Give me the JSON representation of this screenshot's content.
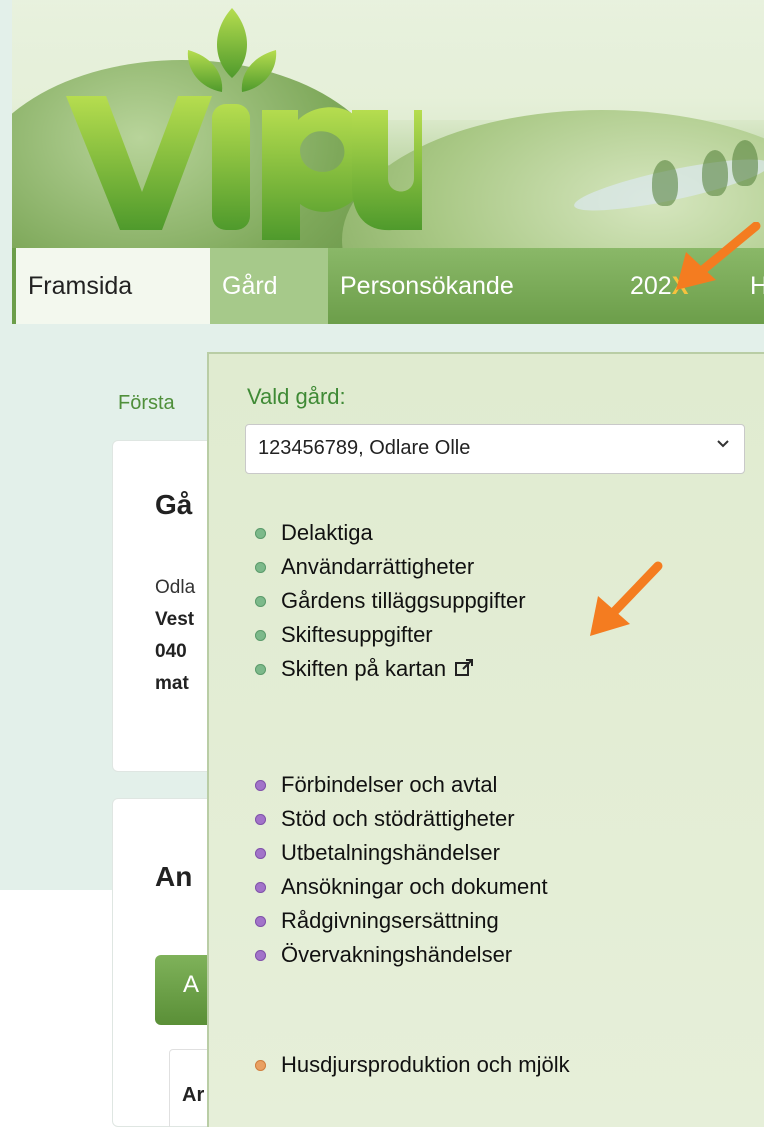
{
  "logo": {
    "text": "vipu",
    "color": "#7bb83a"
  },
  "nav": {
    "items": [
      {
        "label": "Framsida"
      },
      {
        "label": "Gård"
      },
      {
        "label": "Personsökande"
      },
      {
        "label": "202",
        "suffix": "X"
      },
      {
        "label": "H"
      }
    ]
  },
  "page": {
    "breadcrumb": "Första",
    "card1": {
      "title": "Gå",
      "lines": [
        "Odla",
        "Vest",
        "040",
        "mat"
      ]
    },
    "card2": {
      "title": "An",
      "button_label": "A",
      "table_header": "Ar"
    }
  },
  "dropdown": {
    "label": "Vald gård:",
    "selected_farm": "123456789, Odlare Olle",
    "group_green": [
      "Delaktiga",
      "Användarrättigheter",
      "Gårdens tilläggsuppgifter",
      "Skiftesuppgifter",
      "Skiften på kartan"
    ],
    "group_purple": [
      "Förbindelser och avtal",
      "Stöd och stödrättigheter",
      "Utbetalningshändelser",
      "Ansökningar och dokument",
      "Rådgivningsersättning",
      "Övervakningshändelser"
    ],
    "group_orange": [
      "Husdjursproduktion och mjölk"
    ]
  },
  "colors": {
    "nav_green": "#6c9e4a",
    "active_tab": "#a6c98a",
    "link_green": "#3f8a35",
    "annotation_orange": "#f47c20",
    "bullet_green": "#7cb98a",
    "bullet_purple": "#a273c9",
    "bullet_orange": "#e9a062"
  },
  "icons": [
    "external-link-icon",
    "chevron-down-icon",
    "annotation-arrow-icon"
  ]
}
